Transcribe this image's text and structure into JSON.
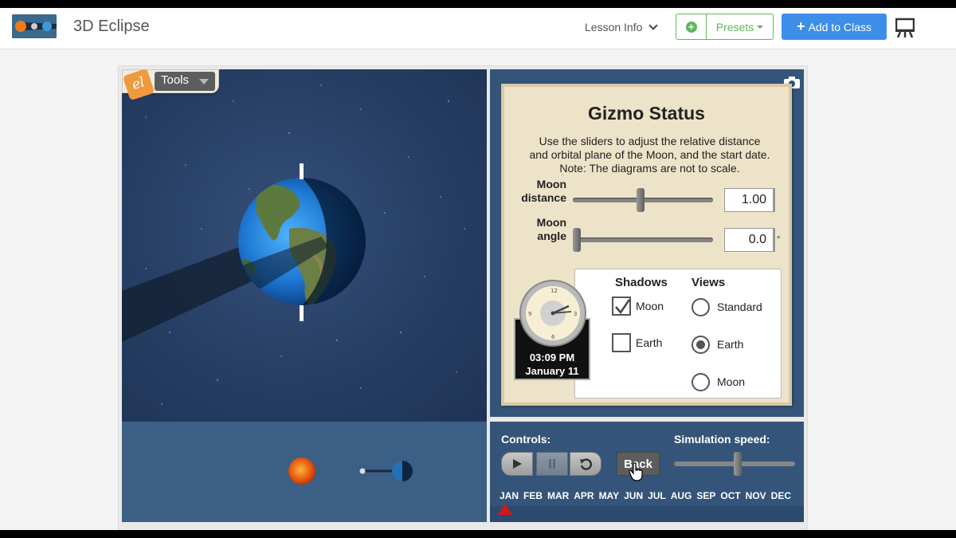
{
  "header": {
    "app_title": "3D Eclipse",
    "lesson_info": "Lesson Info",
    "presets": "Presets",
    "add_to_class": "Add to Class"
  },
  "tools": {
    "label": "Tools",
    "logo_text": "el"
  },
  "status": {
    "title": "Gizmo Status",
    "description": "Use the sliders to adjust the relative distance and orbital plane of the Moon, and the start date. Note: The diagrams are not to scale.",
    "moon_distance": {
      "label_line1": "Moon",
      "label_line2": "distance",
      "value": "1.00",
      "slider_fraction": 0.48
    },
    "moon_angle": {
      "label_line1": "Moon",
      "label_line2": "angle",
      "value": "0.0",
      "unit": "°",
      "slider_fraction": 0.0
    }
  },
  "clock": {
    "time": "03:09 PM",
    "date": "January 11"
  },
  "shadows": {
    "heading": "Shadows",
    "items": [
      {
        "label": "Moon",
        "checked": true
      },
      {
        "label": "Earth",
        "checked": false
      }
    ]
  },
  "views": {
    "heading": "Views",
    "items": [
      {
        "label": "Standard",
        "selected": false
      },
      {
        "label": "Earth",
        "selected": true
      },
      {
        "label": "Moon",
        "selected": false
      }
    ]
  },
  "controls": {
    "label": "Controls:",
    "back": "Back",
    "speed_label": "Simulation speed:",
    "speed_fraction": 0.53
  },
  "months": [
    "JAN",
    "FEB",
    "MAR",
    "APR",
    "MAY",
    "JUN",
    "JUL",
    "AUG",
    "SEP",
    "OCT",
    "NOV",
    "DEC"
  ],
  "colors": {
    "primary_button": "#3d8ee8",
    "presets_green": "#5cb85c",
    "timeline_marker": "#d0191b",
    "status_card": "#ede3c8"
  }
}
